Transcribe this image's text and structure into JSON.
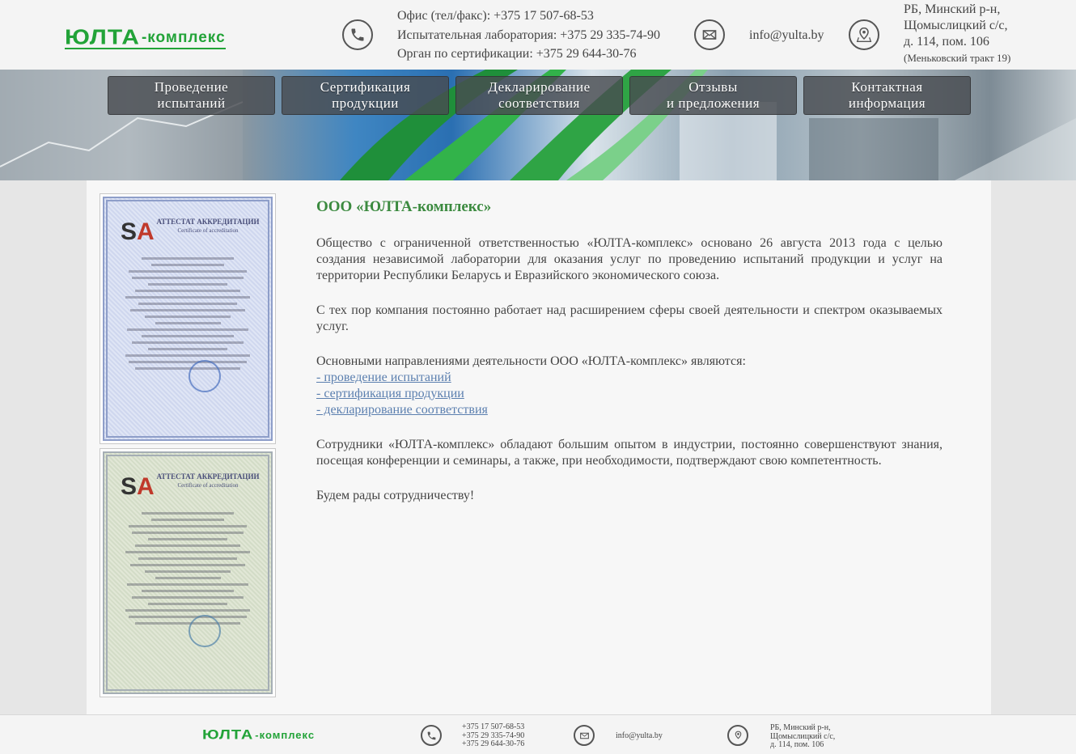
{
  "header": {
    "logo_main": "ЮЛТА",
    "logo_sub": "-комплекс",
    "phones": [
      "Офис (тел/факс): +375 17 507-68-53",
      "Испытательная лаборатория: +375 29 335-74-90",
      "Орган по сертификации: +375 29 644-30-76"
    ],
    "email": "info@yulta.by",
    "address": [
      "РБ, Минский р-н,",
      "Щомыслицкий с/с,",
      "д. 114, пом. 106"
    ],
    "address_note": "(Меньковский тракт 19)",
    "icons": [
      "phone-icon",
      "mail-icon",
      "location-icon"
    ]
  },
  "nav": [
    "Проведение\nиспытаний",
    "Сертификация\nпродукции",
    "Декларирование\nсоответствия",
    "Отзывы\nи предложения",
    "Контактная\nинформация"
  ],
  "content": {
    "title": "ООО «ЮЛТА-комплекс»",
    "p1": "Общество с ограниченной ответственностью «ЮЛТА-комплекс» основано 26 августа 2013 года с целью создания независимой лаборатории для оказания услуг по проведению испытаний продукции и услуг на территории Республики Беларусь и Евразийского экономического союза.",
    "p2": "С тех пор компания постоянно работает над расширением сферы своей деятельности и спектром оказываемых услуг.",
    "p3": "Основными направлениями деятельности ООО «ЮЛТА-комплекс» являются:",
    "links": [
      "- проведение испытаний",
      "- сертификация продукции",
      "- декларирование соответствия"
    ],
    "p4": "Сотрудники «ЮЛТА-комплекс» обладают большим опытом в индустрии, постоянно совершенствуют знания, посещая конференции и семинары, а также, при необходимости, подтверждают свою компетентность.",
    "p5": "Будем рады сотрудничеству!"
  },
  "certificates": [
    {
      "title": "Аттестат аккредитации",
      "subtitle": "Certificate of accreditation"
    },
    {
      "title": "Аттестат аккредитации",
      "subtitle": "Certificate of accreditation"
    }
  ],
  "footer": {
    "logo_main": "ЮЛТА",
    "logo_sub": "-комплекс",
    "phones": [
      "+375 17 507-68-53",
      "+375 29 335-74-90",
      "+375 29 644-30-76"
    ],
    "email": "info@yulta.by",
    "address": [
      "РБ, Минский р-н,",
      "Щомыслицкий с/с,",
      "д. 114, пом. 106"
    ]
  },
  "colors": {
    "accent": "#22a338",
    "title": "#3b8a3f",
    "link": "#5b7faf"
  }
}
